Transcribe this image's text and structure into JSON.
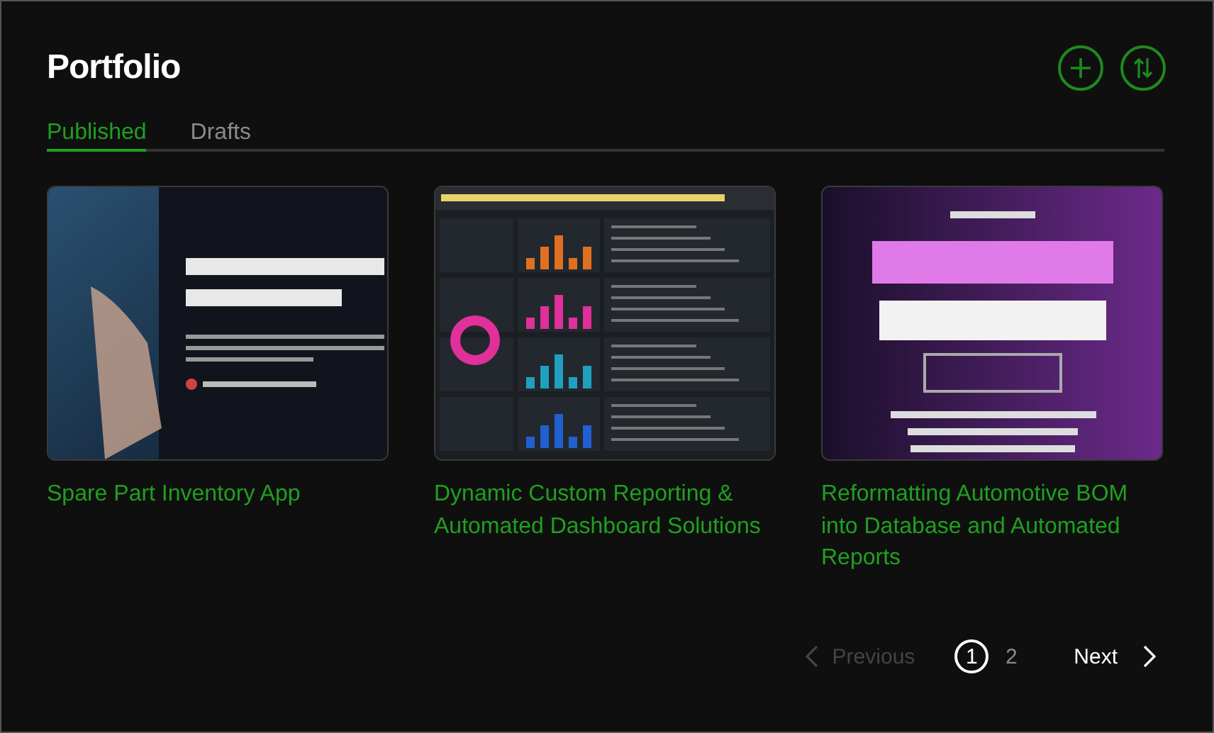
{
  "header": {
    "title": "Portfolio"
  },
  "tabs": [
    {
      "label": "Published",
      "selected": true
    },
    {
      "label": "Drafts",
      "selected": false
    }
  ],
  "projects": [
    {
      "title": "Spare Part Inventory App",
      "kind": "guide"
    },
    {
      "title": "Dynamic Custom Reporting & Automated Dashboard Solutions",
      "kind": "dashboard"
    },
    {
      "title": "Reformatting Automotive BOM into Database and Automated Reports",
      "kind": "poster"
    }
  ],
  "pagination": {
    "previous": {
      "label": "Previous",
      "disabled": true
    },
    "pages": [
      {
        "label": "1",
        "selected": true
      },
      {
        "label": "2",
        "selected": false
      }
    ],
    "next": {
      "label": "Next",
      "disabled": false
    }
  }
}
